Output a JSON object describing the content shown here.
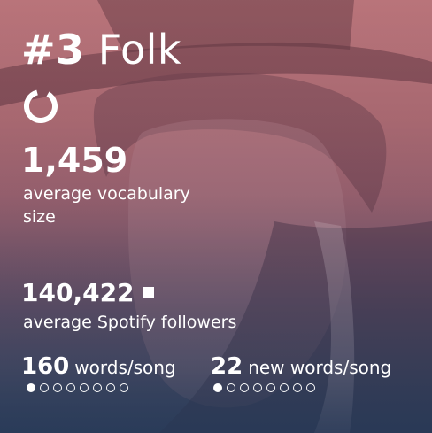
{
  "card": {
    "rank": "#3",
    "genre": "Folk",
    "vocabulary": {
      "value": "1,459",
      "label": "average vocabulary size"
    },
    "followers": {
      "value": "140,422",
      "label": "average Spotify followers"
    },
    "words_per_song": {
      "value": "160",
      "label": "words/song",
      "dots_total": 8,
      "dots_filled": 1
    },
    "new_words_per_song": {
      "value": "22",
      "label": "new words/song",
      "dots_total": 8,
      "dots_filled": 1
    }
  },
  "colors": {
    "top": "#b9747a",
    "middle": "#8a5a6a",
    "bottom": "#34435e",
    "text": "#ffffff"
  },
  "icons": {
    "ring": "progress-ring-icon",
    "square": "square-marker-icon",
    "portrait": "musician-portrait-image"
  }
}
